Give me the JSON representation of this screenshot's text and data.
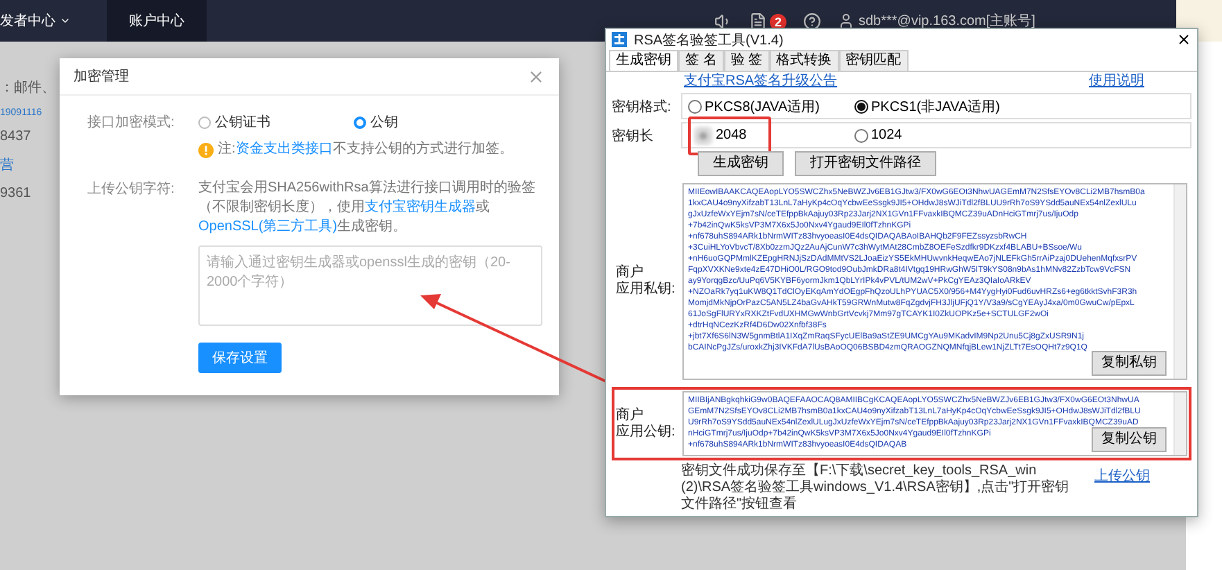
{
  "topbar": {
    "nav": [
      {
        "label": "发者中心",
        "selected": false,
        "dropdown": true
      },
      {
        "label": "账户中心",
        "selected": true,
        "dropdown": false
      }
    ],
    "notification_count": "2",
    "account": "sdb***@vip.163.com[主账号]"
  },
  "background_texts": [
    {
      "text": "：邮件、",
      "kind": "plain"
    },
    {
      "text": "19091116",
      "kind": "link"
    },
    {
      "text": "8437",
      "kind": "plain"
    },
    {
      "text": "营",
      "kind": "link"
    },
    {
      "text": "9361",
      "kind": "plain"
    }
  ],
  "modal": {
    "title": "加密管理",
    "mode_label": "接口加密模式:",
    "mode_options": [
      {
        "label": "公钥证书",
        "selected": false
      },
      {
        "label": "公钥",
        "selected": true
      }
    ],
    "note": [
      {
        "text": "注:",
        "link": false
      },
      {
        "text": "资金支出类接口",
        "link": true
      },
      {
        "text": "不支持公钥的方式进行加签。",
        "link": false
      }
    ],
    "upload_label": "上传公钥字符:",
    "description": [
      {
        "text": "支付宝会用SHA256withRsa算法进行接口调用时的验签（不限制密钥长度），使用",
        "link": false
      },
      {
        "text": "支付宝密钥生成器",
        "link": true
      },
      {
        "text": "或",
        "link": false
      },
      {
        "text": "OpenSSL(第三方工具)",
        "link": true
      },
      {
        "text": "生成密钥。",
        "link": false
      }
    ],
    "placeholder": "请输入通过密钥生成器或openssl生成的密钥（20-2000个字符）",
    "save_button": "保存设置"
  },
  "rsa_tool": {
    "title": "RSA签名验签工具(V1.4)",
    "tabs": [
      {
        "label": "生成密钥",
        "selected": true
      },
      {
        "label": "签 名",
        "selected": false
      },
      {
        "label": "验 签",
        "selected": false
      },
      {
        "label": "格式转换",
        "selected": false
      },
      {
        "label": "密钥匹配",
        "selected": false
      }
    ],
    "notice_link": "支付宝RSA签名升级公告",
    "help_link": "使用说明",
    "format_label": "密钥格式:",
    "format_options": [
      {
        "label": "PKCS8(JAVA适用)",
        "selected": false
      },
      {
        "label": "PKCS1(非JAVA适用)",
        "selected": true
      }
    ],
    "length_label": "密钥长",
    "length_annotated": true,
    "length_options": [
      {
        "label": "2048",
        "selected": true
      },
      {
        "label": "1024",
        "selected": false
      }
    ],
    "buttons": [
      "生成密钥",
      "打开密钥文件路径"
    ],
    "private_key": {
      "label": [
        "商户",
        "应用私钥:"
      ],
      "annotated": false,
      "copy_button": "复制私钥",
      "text": "MIIEowIBAAKCAQEAopLYO5SWCZhx5NeBWZJv6EB1GJtw3/FX0wG6EOt3NhwUAGEmM7N2SfsEYOv8CLi2MB7hsmB0a\n1kxCAU4o9nyXifzabT13LnL7aHyKp4cOqYcbwEeSsgk9JI5+OHdwJ8sWJiTdl2fBLUU9rRh7oS9YSdd5auNEx54nlZexlULu\ngJxUzfeWxYEjm7sN/ceTEfppBkAajuy03Rp23Jarj2NX1GVn1FFvaxkIBQMCZ39uADnHciGTmrj7us/IjuOdp\n+7b42inQwK5ksVP3M7X6x5Jo0Nxv4Ygaud9EIl0fTzhnKGPi\n+nf678uhS894ARk1bNrmWITz83hvyoeasI0E4dsQIDAQABAoIBAHQb2F9FEZssyzsbRwCH\n+3CuiHLYoVbvcT/8Xb0zzmJQz2AuAjCunW7c3hWytMAt28CmbZ8OEFeSzdfkr9DKzxf4BLABU+BSsoe/Wu\n+nH6uoGQPMmlKZEpgHRNJjSzDAdMMtVS2LJoaEizYS5EkMHUwvnkHeqwEAo7jNLEFkGh5rrAiPzaj0DUehenMqfxsrPV\nFqpXVXKNe9xte4zE47DHiO0L/RGO9tod9OubJmkDRa8t4IVtgq19HRwGhW5IT9kYS08n9bAs1hMNv82ZzbTcw9VcFSN\nay9YorqgBzc/UuPq6V5KYBF6yormJkm1QbLYrIPk4vPVL/tUM2wV+PkCgYEAz3QIaIoARkEV\n+NZOaRk7yq1uKW8Q1TdClOyEKqAmYdOEgpFhQzoULhPYUAC5X0/956+M4YygHyi0Fud6uvHRZs6+eg6tkktSvhF3R3h\nMomjdMkNjpOrPazC5AN5LZ4baGvAHkT59GRWnMutw8FqZgdvjFH3JljUFjQ1Y/V3a9/sCgYEAyJ4xa/0m0GwuCw/pEpxL\n61JoSgFlURYxRXKZtFvdUXHMGwWnbGrtVcvkj7Mm97gTCAYK1I0ZkUOPKz5e+SCTULGF2wOi\n+dtrHqNCezKzRf4D6Dw02Xnfbf38Fs\n+jbt7Xf6S6lN3W5gnmBtlA1IXqZmRaqSFycUElBa9aStZE9UMCgYAu9MKadvIM9Np2Unu5Cj8gZxUSR9N1j\nbCAINcPgJZs/uroxkZhj3IVKFdA7lUsBAoOQ06BSBD4zmQRAOGZNQMNfqjBLew1NjZLTt7EsOQHt7z9Q1Q"
    },
    "public_key": {
      "label": [
        "商户",
        "应用公钥:"
      ],
      "annotated": true,
      "copy_button": "复制公钥",
      "text": "MIIBIjANBgkqhkiG9w0BAQEFAAOCAQ8AMIIBCgKCAQEAopLYO5SWCZhx5NeBWZJv6EB1GJtw3/FX0wG6EOt3NhwUA\nGEmM7N2SfsEYOv8CLi2MB7hsmB0a1kxCAU4o9nyXifzabT13LnL7aHyKp4cOqYcbwEeSsgk9JI5+OHdwJ8sWJiTdl2fBLU\nU9rRh7oS9YSdd5auNEx54nlZexlULugJxUzfeWxYEjm7sN/ceTEfppBkAajuy03Rp23Jarj2NX1GVn1FFvaxkIBQMCZ39uAD\nnHciGTmrj7us/IjuOdp+7b42inQwK5ksVP3M7X6x5Jo0Nxv4Ygaud9EIl0fTzhnKGPi\n+nf678uhS894ARk1bNrmWITz83hvyoeasI0E4dsQIDAQAB"
    },
    "save_note": "密钥文件成功保存至【F:\\下载\\secret_key_tools_RSA_win (2)\\RSA签名验签工具windows_V1.4\\RSA密钥】,点击\"打开密钥文件路径\"按钮查看",
    "upload_link": "上传公钥"
  }
}
